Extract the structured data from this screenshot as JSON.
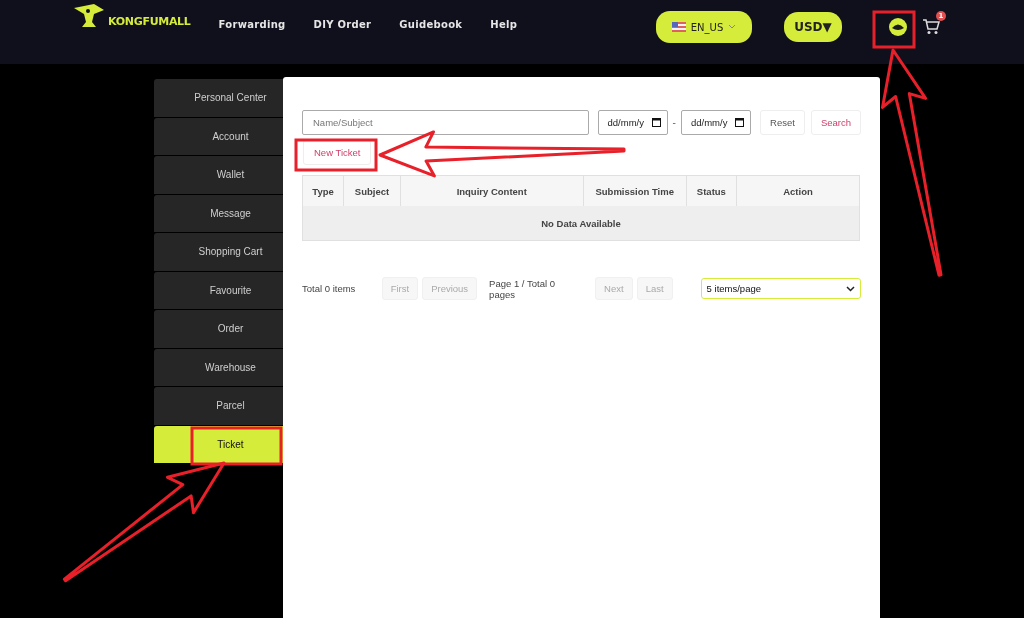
{
  "header": {
    "logo": "KONGFUMALL",
    "nav": [
      "Forwarding",
      "DIY Order",
      "Guidebook",
      "Help"
    ],
    "language": "EN_US",
    "currency": "USD▼",
    "cart_count": "1"
  },
  "sidebar": {
    "items": [
      {
        "label": "Personal Center",
        "selected": false
      },
      {
        "label": "Account",
        "selected": false
      },
      {
        "label": "Wallet",
        "selected": false
      },
      {
        "label": "Message",
        "selected": false
      },
      {
        "label": "Shopping Cart",
        "selected": false
      },
      {
        "label": "Favourite",
        "selected": false
      },
      {
        "label": "Order",
        "selected": false
      },
      {
        "label": "Warehouse",
        "selected": false
      },
      {
        "label": "Parcel",
        "selected": false
      },
      {
        "label": "Ticket",
        "selected": true
      }
    ]
  },
  "filters": {
    "search": {
      "placeholder": "Name/Subject"
    },
    "date_from": "dd/mm/y",
    "separator": "-",
    "date_to": "dd/mm/y",
    "reset": "Reset",
    "search_button": "Search"
  },
  "new_ticket": "New Ticket",
  "table": {
    "columns": [
      "Type",
      "Subject",
      "Inquiry Content",
      "Submission Time",
      "Status",
      "Action"
    ],
    "empty": "No Data Available"
  },
  "pagination": {
    "total": "Total 0 items",
    "first": "First",
    "previous": "Previous",
    "page_info": "Page 1 / Total 0 pages",
    "next": "Next",
    "last": "Last",
    "page_size": "5 items/page"
  }
}
